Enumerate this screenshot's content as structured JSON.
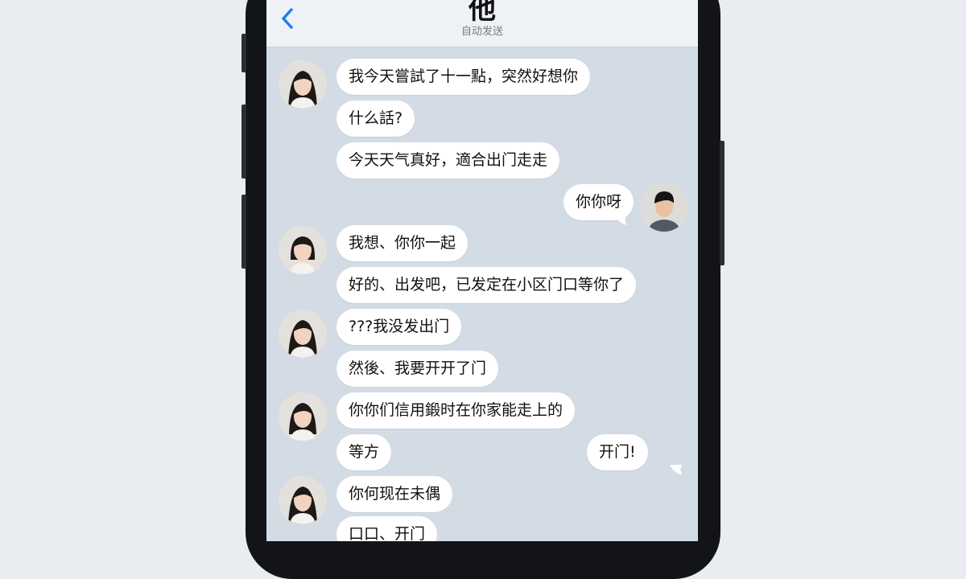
{
  "header": {
    "title": "他",
    "status": "自动发送"
  },
  "messages": [
    {
      "side": "left",
      "text": "我今天嘗試了十一點，突然好想你"
    },
    {
      "side": "left",
      "text": "什么話?"
    },
    {
      "side": "left",
      "text": "今天天气真好，適合出门走走"
    },
    {
      "side": "right",
      "text": "你你呀"
    },
    {
      "side": "left",
      "text": "我想、你你一起"
    },
    {
      "side": "left",
      "text": "好的、出发吧，已发定在小区门口等你了"
    },
    {
      "side": "left",
      "text": "???我没发出门"
    },
    {
      "side": "left",
      "text": "然後、我要开开了门"
    },
    {
      "side": "left",
      "text": "你你们信用鍛时在你家能走上的"
    },
    {
      "side": "left",
      "text": "等方"
    },
    {
      "side": "right",
      "text": "开门!"
    },
    {
      "side": "left",
      "text": "你何现在未偶"
    },
    {
      "side": "left",
      "text": "口口、开门"
    }
  ],
  "colors": {
    "chat_background": "#d3dbe5",
    "bubble": "#ffffff",
    "accent": "#1a7cf5"
  }
}
